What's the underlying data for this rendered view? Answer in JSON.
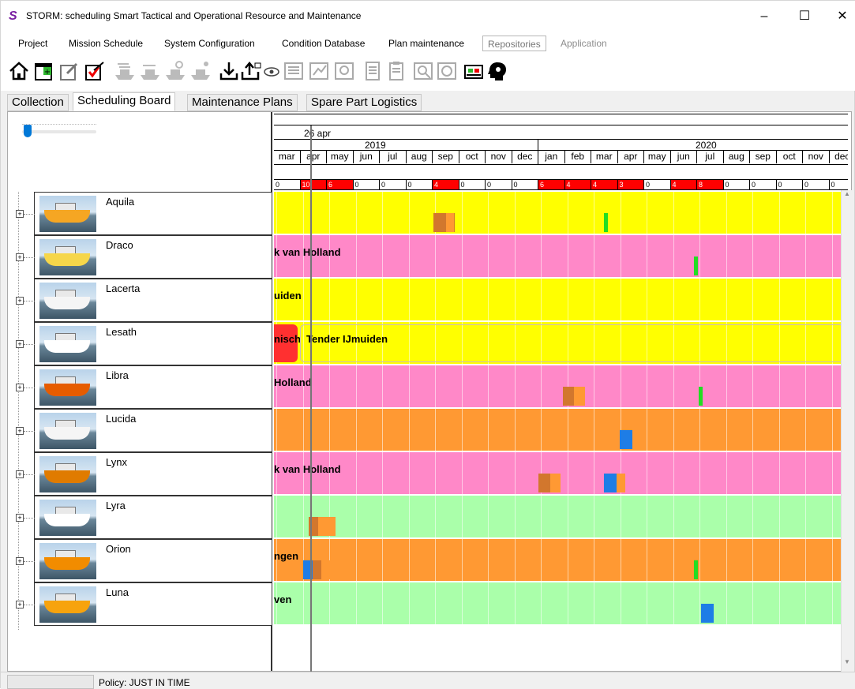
{
  "window": {
    "title": "STORM: scheduling Smart Tactical and Operational Resource and Maintenance",
    "minimize": "–",
    "maximize": "☐",
    "close": "✕"
  },
  "menu": [
    "Project",
    "Mission Schedule",
    "System Configuration",
    "Condition Database",
    "Plan maintenance",
    "Repositories",
    "Application"
  ],
  "tabs": [
    "Collection",
    "Scheduling Board",
    "Maintenance Plans",
    "Spare Part Logistics"
  ],
  "timeline": {
    "current_date": "26 apr",
    "years": [
      "2019",
      "2020"
    ],
    "months": [
      "mar",
      "apr",
      "may",
      "jun",
      "jul",
      "aug",
      "sep",
      "oct",
      "nov",
      "dec",
      "jan",
      "feb",
      "mar",
      "apr",
      "may",
      "jun",
      "jul",
      "aug",
      "sep",
      "oct",
      "nov",
      "dec"
    ],
    "counts": [
      "0",
      "10",
      "6",
      "0",
      "0",
      "0",
      "4",
      "0",
      "0",
      "0",
      "6",
      "4",
      "4",
      "3",
      "0",
      "4",
      "8",
      "0",
      "0",
      "0",
      "0",
      "0"
    ]
  },
  "colors": {
    "yellow": "#ffff00",
    "pink": "#ff88c8",
    "orange": "#ff9933",
    "green": "#aaffaa",
    "red": "#ff3030",
    "brown": "#d2772d",
    "blue": "#1e7de6",
    "lime": "#22dd22"
  },
  "ships": [
    {
      "name": "Aquila",
      "lane_color": "yellow",
      "label": ""
    },
    {
      "name": "Draco",
      "lane_color": "pink",
      "label": "k van Holland"
    },
    {
      "name": "Lacerta",
      "lane_color": "yellow",
      "label": "uiden"
    },
    {
      "name": "Lesath",
      "lane_color": "yellow",
      "label": "Tender IJmuiden",
      "label2": "nisch"
    },
    {
      "name": "Libra",
      "lane_color": "pink",
      "label": "Holland"
    },
    {
      "name": "Lucida",
      "lane_color": "orange",
      "label": ""
    },
    {
      "name": "Lynx",
      "lane_color": "pink",
      "label": "k van Holland"
    },
    {
      "name": "Lyra",
      "lane_color": "green",
      "label": ""
    },
    {
      "name": "Orion",
      "lane_color": "orange",
      "label": "ngen"
    },
    {
      "name": "Luna",
      "lane_color": "green",
      "label": "ven"
    }
  ],
  "status": {
    "policy": "Policy: JUST IN TIME"
  }
}
